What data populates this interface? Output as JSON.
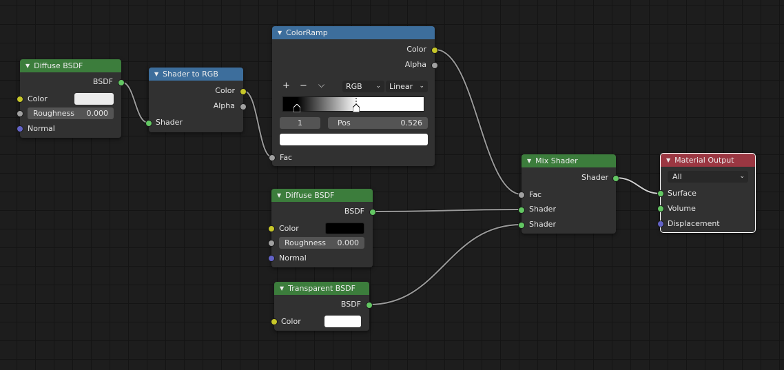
{
  "colors": {
    "shader_socket": "#63c763",
    "color_socket": "#c7c729",
    "float_socket": "#a1a1a1",
    "vector_socket": "#6363c7",
    "shader_header": "#3c7d3c",
    "converter_header": "#3d6e9c",
    "output_header": "#9b3742"
  },
  "nodes": {
    "diffuse1": {
      "title": "Diffuse BSDF",
      "out_bsdf": "BSDF",
      "in_color": "Color",
      "color_value": "#ececec",
      "roughness_label": "Roughness",
      "roughness_value": "0.000",
      "in_normal": "Normal"
    },
    "shader_to_rgb": {
      "title": "Shader to RGB",
      "out_color": "Color",
      "out_alpha": "Alpha",
      "in_shader": "Shader"
    },
    "colorramp": {
      "title": "ColorRamp",
      "out_color": "Color",
      "out_alpha": "Alpha",
      "add_icon": "+",
      "remove_icon": "−",
      "menu_icon": "⌵",
      "mode": "RGB",
      "interpolation": "Linear",
      "stop_index": "1",
      "pos_label": "Pos",
      "pos_value": "0.526",
      "stop_color": "#ffffff",
      "in_fac": "Fac"
    },
    "diffuse2": {
      "title": "Diffuse BSDF",
      "out_bsdf": "BSDF",
      "in_color": "Color",
      "color_value": "#000000",
      "roughness_label": "Roughness",
      "roughness_value": "0.000",
      "in_normal": "Normal"
    },
    "transparent": {
      "title": "Transparent BSDF",
      "out_bsdf": "BSDF",
      "in_color": "Color",
      "color_value": "#ffffff"
    },
    "mix_shader": {
      "title": "Mix Shader",
      "out_shader": "Shader",
      "in_fac": "Fac",
      "in_shader1": "Shader",
      "in_shader2": "Shader"
    },
    "material_output": {
      "title": "Material Output",
      "target": "All",
      "in_surface": "Surface",
      "in_volume": "Volume",
      "in_displacement": "Displacement"
    }
  }
}
